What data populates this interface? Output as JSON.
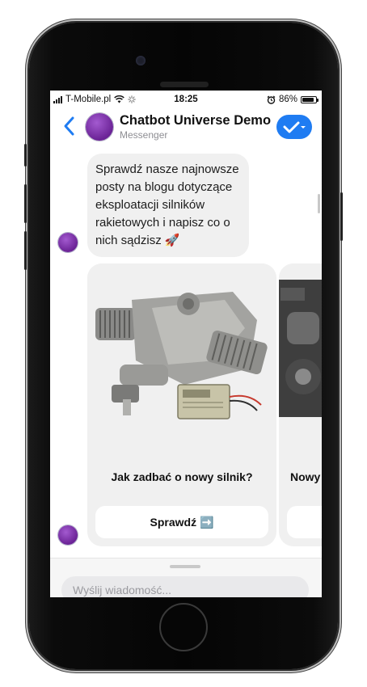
{
  "status_bar": {
    "carrier": "T-Mobile.pl",
    "time": "18:25",
    "battery": "86%",
    "battery_level": 0.86
  },
  "header": {
    "title": "Chatbot Universe Demo",
    "subtitle": "Messenger",
    "back_icon": "chevron-left-icon",
    "action_icon": "checkmark-dropdown-icon",
    "accent_color": "#1f7cf2"
  },
  "message": {
    "text": "Sprawdź nasze najnowsze posty na blogu dotyczące eksploatacji silników rakietowych i napisz co o nich sądzisz 🚀"
  },
  "cards": [
    {
      "title": "Jak zadbać o nowy silnik?",
      "button": "Sprawdź ➡️",
      "image": "engine-photo"
    },
    {
      "title": "Nowy",
      "button": "",
      "image": "engine-photo"
    }
  ],
  "composer": {
    "placeholder": "Wyślij wiadomość..."
  }
}
